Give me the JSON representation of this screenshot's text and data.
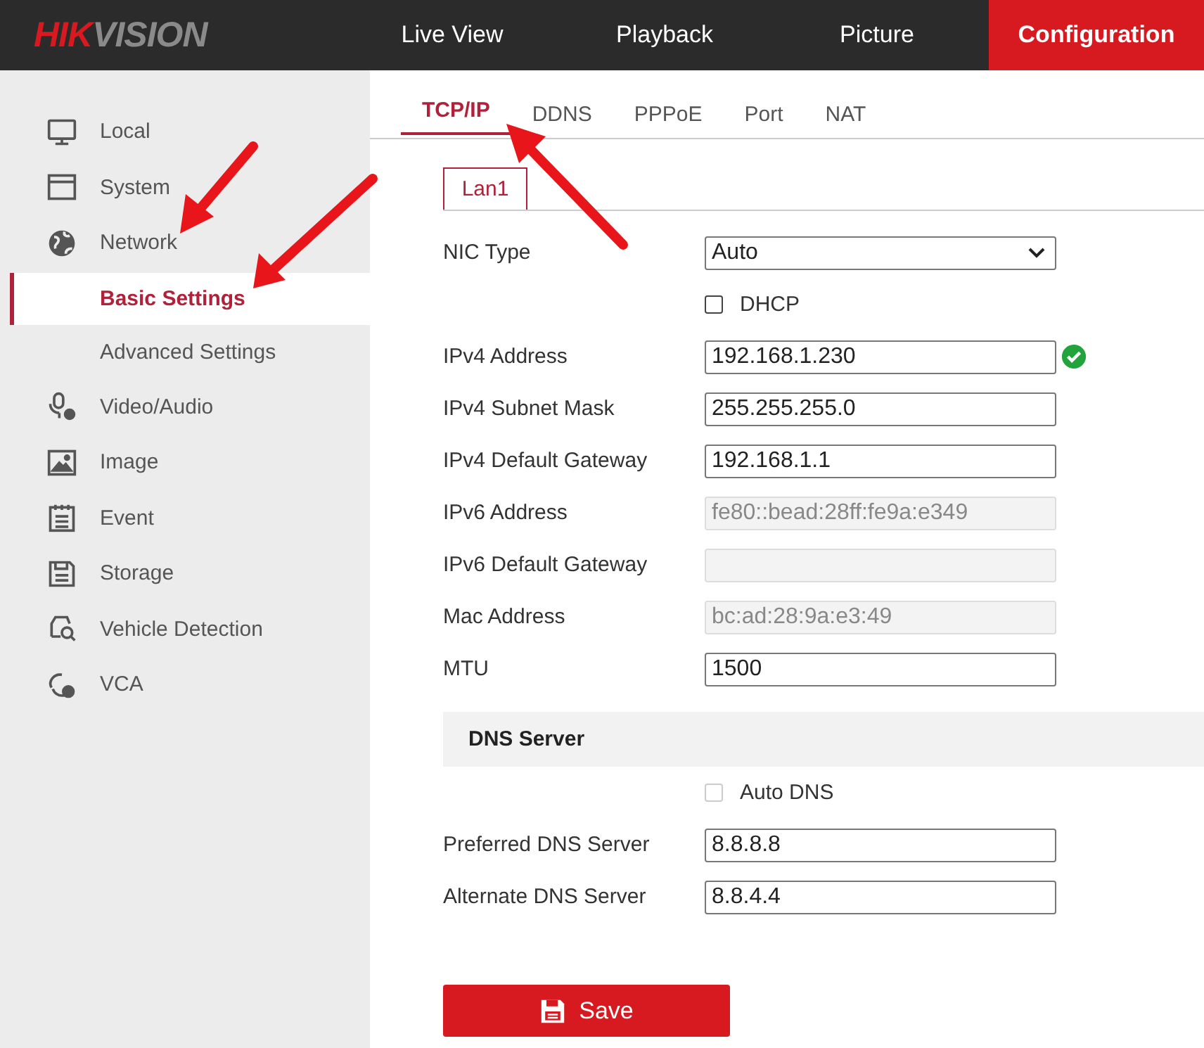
{
  "header": {
    "logo": [
      "HIK",
      "VISION"
    ],
    "nav": [
      {
        "label": "Live View",
        "selected": false
      },
      {
        "label": "Playback",
        "selected": false
      },
      {
        "label": "Picture",
        "selected": false
      },
      {
        "label": "Configuration",
        "selected": true
      }
    ]
  },
  "sidebar": {
    "items": [
      {
        "label": "Local",
        "selected": false
      },
      {
        "label": "System",
        "selected": false
      },
      {
        "label": "Network",
        "selected": false,
        "children": [
          {
            "label": "Basic Settings",
            "selected": true
          },
          {
            "label": "Advanced Settings",
            "selected": false
          }
        ]
      },
      {
        "label": "Video/Audio",
        "selected": false
      },
      {
        "label": "Image",
        "selected": false
      },
      {
        "label": "Event",
        "selected": false
      },
      {
        "label": "Storage",
        "selected": false
      },
      {
        "label": "Vehicle Detection",
        "selected": false
      },
      {
        "label": "VCA",
        "selected": false
      }
    ]
  },
  "tabs": [
    {
      "label": "TCP/IP",
      "selected": true
    },
    {
      "label": "DDNS",
      "selected": false
    },
    {
      "label": "PPPoE",
      "selected": false
    },
    {
      "label": "Port",
      "selected": false
    },
    {
      "label": "NAT",
      "selected": false
    }
  ],
  "subtabs": [
    {
      "label": "Lan1",
      "selected": true
    }
  ],
  "fields": [
    {
      "kind": "select",
      "label": "NIC Type",
      "value": "Auto",
      "disabled": false
    },
    {
      "kind": "checkbox",
      "label": "DHCP",
      "checked": false,
      "disabled": false
    },
    {
      "kind": "text",
      "label": "IPv4 Address",
      "value": "192.168.1.230",
      "disabled": false,
      "valid": true
    },
    {
      "kind": "text",
      "label": "IPv4 Subnet Mask",
      "value": "255.255.255.0",
      "disabled": false,
      "valid": false
    },
    {
      "kind": "text",
      "label": "IPv4 Default Gateway",
      "value": "192.168.1.1",
      "disabled": false,
      "valid": false
    },
    {
      "kind": "text",
      "label": "IPv6 Address",
      "value": "fe80::bead:28ff:fe9a:e349",
      "disabled": true,
      "valid": false
    },
    {
      "kind": "text",
      "label": "IPv6 Default Gateway",
      "disabled": true,
      "valid": false
    },
    {
      "kind": "text",
      "label": "Mac Address",
      "value": "bc:ad:28:9a:e3:49",
      "disabled": true,
      "valid": false
    },
    {
      "kind": "text",
      "label": "MTU",
      "value": "1500",
      "disabled": false,
      "valid": false
    }
  ],
  "dns": {
    "title": "DNS Server",
    "fields": [
      {
        "kind": "checkbox",
        "label": "Auto DNS",
        "checked": false,
        "disabled": true
      },
      {
        "kind": "text",
        "label": "Preferred DNS Server",
        "value": "8.8.8.8",
        "disabled": false,
        "valid": false
      },
      {
        "kind": "text",
        "label": "Alternate DNS Server",
        "value": "8.8.4.4",
        "disabled": false,
        "valid": false
      }
    ]
  },
  "save_button": {
    "label": "Save"
  }
}
